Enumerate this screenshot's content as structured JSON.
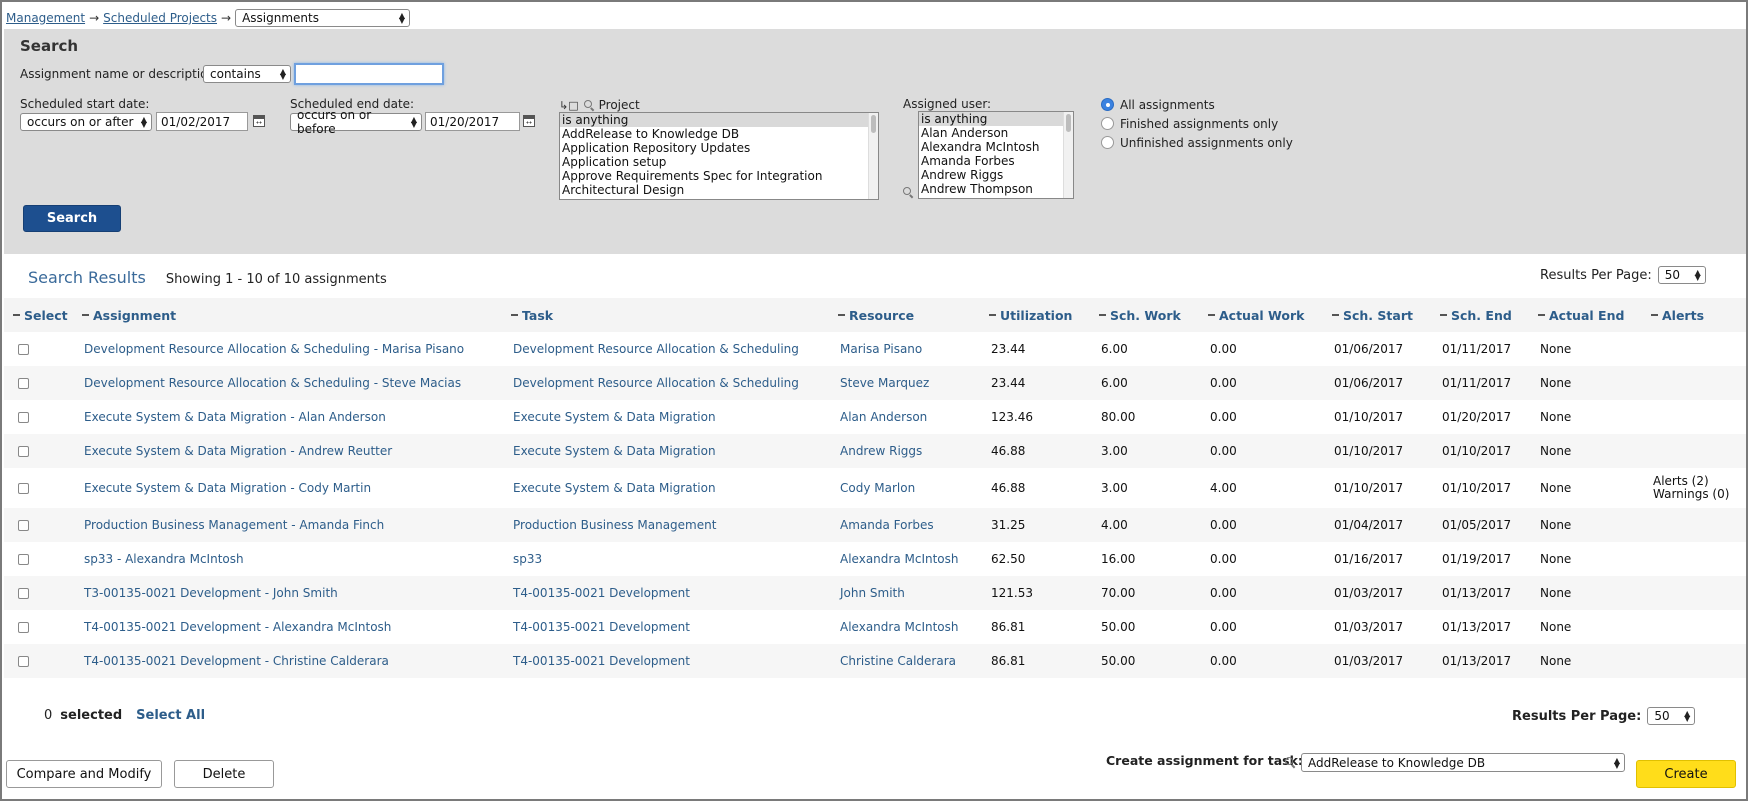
{
  "breadcrumb": {
    "items": [
      "Management",
      "Scheduled Projects"
    ],
    "arrow": "→",
    "current_select": "Assignments"
  },
  "search": {
    "title": "Search",
    "name_label": "Assignment name or description",
    "name_operator": "contains",
    "name_value": "",
    "start_label": "Scheduled start date:",
    "start_operator": "occurs on or after",
    "start_value": "01/02/2017",
    "end_label": "Scheduled end date:",
    "end_operator": "occurs on or before",
    "end_value": "01/20/2017",
    "project_label": "Project",
    "project_options": [
      "is anything",
      "AddRelease to Knowledge DB",
      "Application Repository Updates",
      "Application setup",
      "Approve Requirements Spec for Integration",
      "Architectural Design"
    ],
    "user_label": "Assigned user:",
    "user_options": [
      "is anything",
      "Alan Anderson",
      "Alexandra McIntosh",
      "Amanda Forbes",
      "Andrew Riggs",
      "Andrew Thompson"
    ],
    "radio_options": [
      "All assignments",
      "Finished assignments only",
      "Unfinished assignments only"
    ],
    "radio_selected": 0,
    "button_label": "Search"
  },
  "results": {
    "title": "Search Results",
    "count_text": "Showing 1 - 10 of 10 assignments",
    "per_page_label": "Results Per Page:",
    "per_page_value": "50",
    "columns": {
      "select": "Select",
      "assignment": "Assignment",
      "task": "Task",
      "resource": "Resource",
      "utilization": "Utilization",
      "sch_work": "Sch. Work",
      "actual_work": "Actual Work",
      "sch_start": "Sch. Start",
      "sch_end": "Sch. End",
      "actual_end": "Actual End",
      "alerts": "Alerts"
    },
    "rows": [
      {
        "assignment": "Development Resource Allocation & Scheduling - Marisa Pisano",
        "task": "Development Resource Allocation & Scheduling",
        "resource": "Marisa Pisano",
        "utilization": "23.44",
        "sch_work": "6.00",
        "actual_work": "0.00",
        "sch_start": "01/06/2017",
        "sch_end": "01/11/2017",
        "actual_end": "None",
        "alerts": "",
        "warnings": ""
      },
      {
        "assignment": "Development Resource Allocation & Scheduling - Steve Macias",
        "task": "Development Resource Allocation & Scheduling",
        "resource": "Steve Marquez",
        "utilization": "23.44",
        "sch_work": "6.00",
        "actual_work": "0.00",
        "sch_start": "01/06/2017",
        "sch_end": "01/11/2017",
        "actual_end": "None",
        "alerts": "",
        "warnings": ""
      },
      {
        "assignment": "Execute System & Data Migration - Alan Anderson",
        "task": "Execute System & Data Migration",
        "resource": "Alan Anderson",
        "utilization": "123.46",
        "sch_work": "80.00",
        "actual_work": "0.00",
        "sch_start": "01/10/2017",
        "sch_end": "01/20/2017",
        "actual_end": "None",
        "alerts": "",
        "warnings": ""
      },
      {
        "assignment": "Execute System & Data Migration - Andrew Reutter",
        "task": "Execute System & Data Migration",
        "resource": "Andrew Riggs",
        "utilization": "46.88",
        "sch_work": "3.00",
        "actual_work": "0.00",
        "sch_start": "01/10/2017",
        "sch_end": "01/10/2017",
        "actual_end": "None",
        "alerts": "",
        "warnings": ""
      },
      {
        "assignment": "Execute System & Data Migration - Cody Martin",
        "task": "Execute System & Data Migration",
        "resource": "Cody Marlon",
        "utilization": "46.88",
        "sch_work": "3.00",
        "actual_work": "4.00",
        "sch_start": "01/10/2017",
        "sch_end": "01/10/2017",
        "actual_end": "None",
        "alerts": "Alerts (2)",
        "warnings": "Warnings (0)"
      },
      {
        "assignment": "Production Business Management - Amanda Finch",
        "task": "Production Business Management",
        "resource": "Amanda Forbes",
        "utilization": "31.25",
        "sch_work": "4.00",
        "actual_work": "0.00",
        "sch_start": "01/04/2017",
        "sch_end": "01/05/2017",
        "actual_end": "None",
        "alerts": "",
        "warnings": ""
      },
      {
        "assignment": "sp33 - Alexandra McIntosh",
        "task": "sp33",
        "resource": "Alexandra McIntosh",
        "utilization": "62.50",
        "sch_work": "16.00",
        "actual_work": "0.00",
        "sch_start": "01/16/2017",
        "sch_end": "01/19/2017",
        "actual_end": "None",
        "alerts": "",
        "warnings": ""
      },
      {
        "assignment": "T3-00135-0021 Development - John Smith",
        "task": "T4-00135-0021 Development",
        "resource": "John Smith",
        "utilization": "121.53",
        "sch_work": "70.00",
        "actual_work": "0.00",
        "sch_start": "01/03/2017",
        "sch_end": "01/13/2017",
        "actual_end": "None",
        "alerts": "",
        "warnings": ""
      },
      {
        "assignment": "T4-00135-0021 Development - Alexandra McIntosh",
        "task": "T4-00135-0021 Development",
        "resource": "Alexandra McIntosh",
        "utilization": "86.81",
        "sch_work": "50.00",
        "actual_work": "0.00",
        "sch_start": "01/03/2017",
        "sch_end": "01/13/2017",
        "actual_end": "None",
        "alerts": "",
        "warnings": ""
      },
      {
        "assignment": "T4-00135-0021 Development - Christine Calderara",
        "task": "T4-00135-0021 Development",
        "resource": "Christine Calderara",
        "utilization": "86.81",
        "sch_work": "50.00",
        "actual_work": "0.00",
        "sch_start": "01/03/2017",
        "sch_end": "01/13/2017",
        "actual_end": "None",
        "alerts": "",
        "warnings": ""
      }
    ]
  },
  "footer": {
    "selected_count": "0",
    "selected_label": "selected",
    "select_all": "Select All",
    "per_page_label": "Results Per Page:",
    "per_page_value": "50",
    "compare_button": "Compare and Modify",
    "delete_button": "Delete",
    "create_label": "Create assignment for task:",
    "create_task_value": "AddRelease to Knowledge DB",
    "create_button": "Create"
  },
  "colors": {
    "link": "#2d5d8a",
    "search_button": "#1d4f8f",
    "create_button": "#ffdd1a",
    "panel_bg": "#dcdcdc"
  }
}
